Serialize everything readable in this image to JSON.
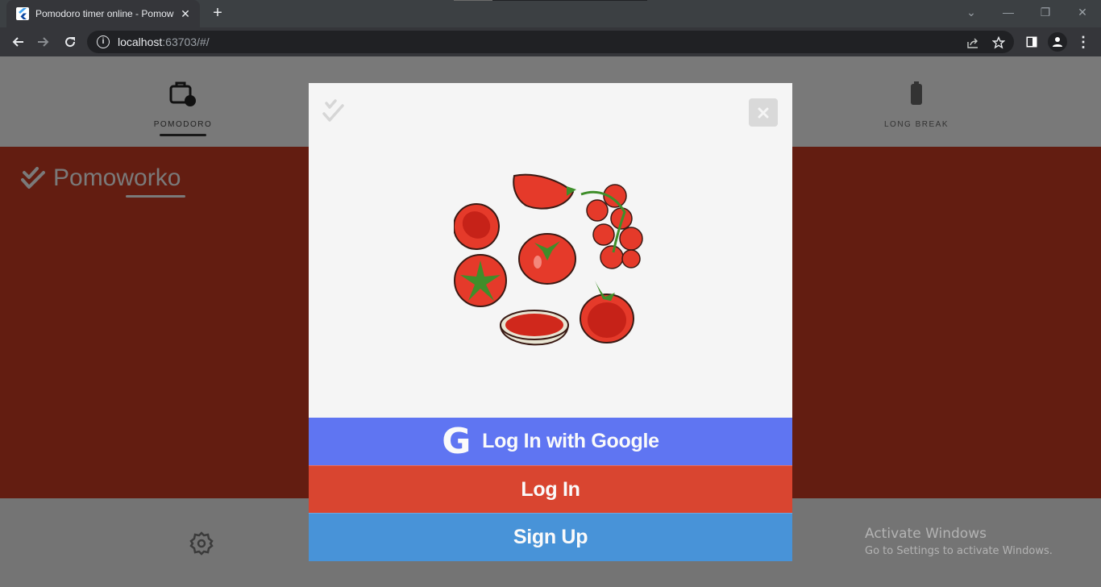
{
  "browser": {
    "tab_title": "Pomodoro timer online - Pomow",
    "tab_close_glyph": "✕",
    "new_tab_glyph": "+",
    "url_host": "localhost",
    "url_rest": ":63703/#/",
    "window_controls": {
      "tab_search_glyph": "⌄",
      "minimize_glyph": "—",
      "restore_glyph": "❐",
      "close_glyph": "✕"
    },
    "menu_glyph": "⋮"
  },
  "app": {
    "mode_tabs": [
      {
        "label": "POMODORO",
        "icon": "briefcase-clock-icon",
        "active": true
      },
      {
        "label": "LONG BREAK",
        "icon": "battery-icon",
        "active": false
      }
    ],
    "brand_name": "Pomoworko",
    "settings_icon": "gear-icon"
  },
  "modal": {
    "close_glyph": "✕",
    "hero_image_alt": "tomatoes illustration",
    "buttons": {
      "google_icon_glyph": "G",
      "google_label": "Log In with Google",
      "login_label": "Log In",
      "signup_label": "Sign Up"
    },
    "colors": {
      "google": "#5f75f2",
      "login": "#d94530",
      "signup": "#4893d8"
    }
  },
  "os_watermark": {
    "title": "Activate Windows",
    "subtitle": "Go to Settings to activate Windows."
  }
}
